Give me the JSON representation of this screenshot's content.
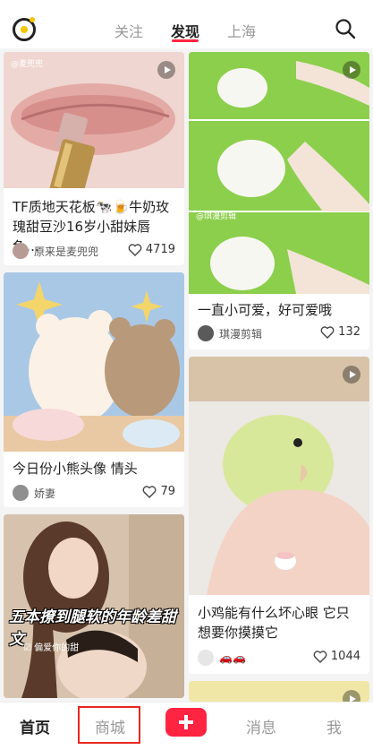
{
  "header": {
    "tabs": [
      "关注",
      "发现",
      "上海"
    ],
    "active_tab": "发现"
  },
  "feed": {
    "left": [
      {
        "title": "TF质地天花板🐄🍺牛奶玫瑰甜豆沙16岁小甜妹唇色…",
        "author": "原来是麦兜兜",
        "likes": "4719",
        "image_watermark": "@麦兜兜"
      },
      {
        "title": "今日份小熊头像 情头",
        "author": "娇妻",
        "likes": "79"
      },
      {
        "overlay_text": "五本撩到腿软的年龄差甜文",
        "tag": "☑ 偏爱你的甜"
      }
    ],
    "right": [
      {
        "title": "一直小可爱，好可爱哦",
        "author": "琪漫剪辑",
        "likes": "132",
        "image_watermark": "@琪漫剪辑"
      },
      {
        "title": "小鸡能有什么坏心眼 它只想要你摸摸它",
        "author": "🚗🚗",
        "likes": "1044"
      }
    ]
  },
  "bottom_nav": {
    "items": [
      "首页",
      "商城",
      "消息",
      "我"
    ],
    "active": "首页",
    "highlighted": "商城"
  },
  "colors": {
    "accent": "#ff2442",
    "highlight_box": "#e8281f"
  }
}
